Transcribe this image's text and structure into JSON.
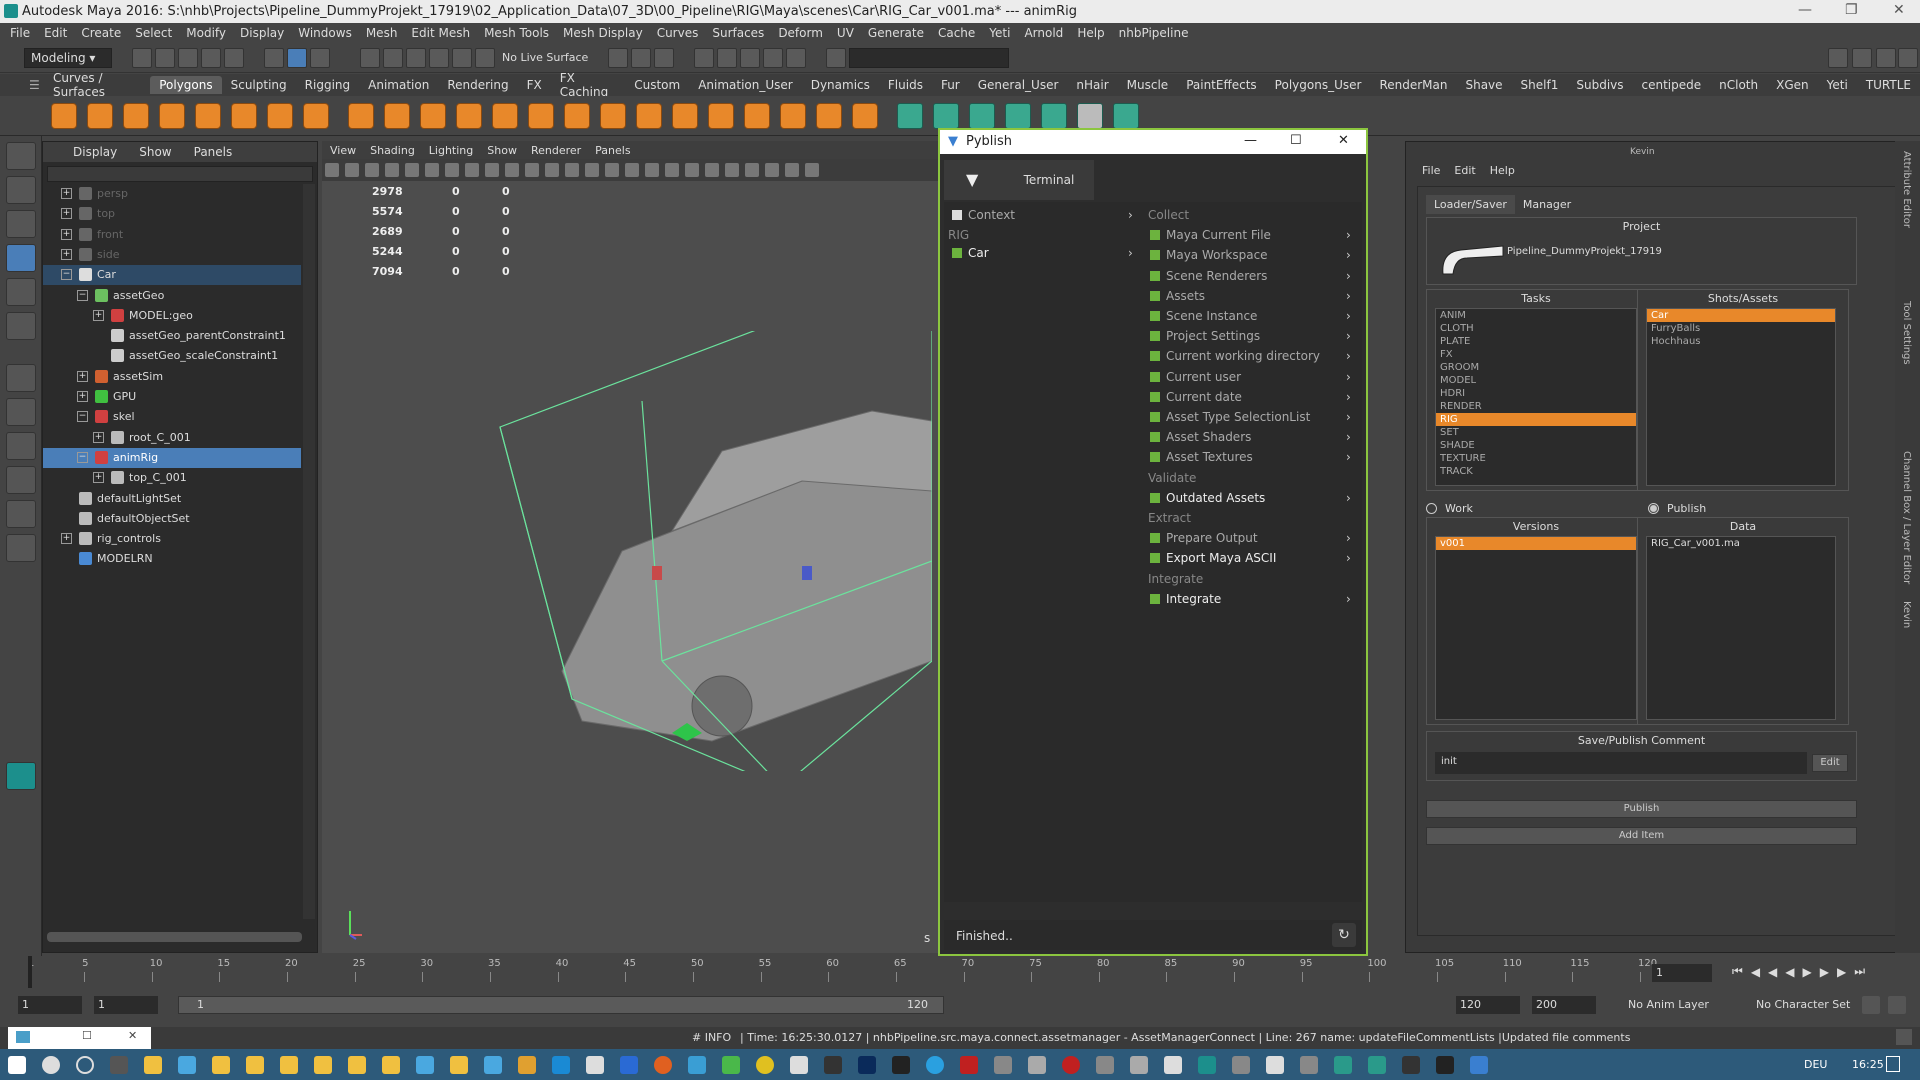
{
  "window": {
    "title": "Autodesk Maya 2016: S:\\nhb\\Projects\\Pipeline_DummyProjekt_17919\\02_Application_Data\\07_3D\\00_Pipeline\\RIG\\Maya\\scenes\\Car\\RIG_Car_v001.ma*   ---   animRig"
  },
  "menubar": [
    "File",
    "Edit",
    "Create",
    "Select",
    "Modify",
    "Display",
    "Windows",
    "Mesh",
    "Edit Mesh",
    "Mesh Tools",
    "Mesh Display",
    "Curves",
    "Surfaces",
    "Deform",
    "UV",
    "Generate",
    "Cache",
    "Yeti",
    "Arnold",
    "Help",
    "nhbPipeline"
  ],
  "statusline": {
    "mode": "Modeling",
    "live_surface": "No Live Surface"
  },
  "shelf_tabs": {
    "items": [
      "Curves / Surfaces",
      "Polygons",
      "Sculpting",
      "Rigging",
      "Animation",
      "Rendering",
      "FX",
      "FX Caching",
      "Custom",
      "Animation_User",
      "Dynamics",
      "Fluids",
      "Fur",
      "General_User",
      "nHair",
      "Muscle",
      "PaintEffects",
      "Polygons_User",
      "RenderMan",
      "Shave",
      "Shelf1",
      "Subdivs",
      "centipede",
      "nCloth",
      "XGen",
      "Yeti",
      "TURTLE"
    ],
    "active": "Polygons"
  },
  "outliner": {
    "menu": [
      "Display",
      "Show",
      "Panels"
    ],
    "items": [
      {
        "label": "persp",
        "depth": 0,
        "dim": true
      },
      {
        "label": "top",
        "depth": 0,
        "dim": true
      },
      {
        "label": "front",
        "depth": 0,
        "dim": true
      },
      {
        "label": "side",
        "depth": 0,
        "dim": true
      },
      {
        "label": "Car",
        "depth": 0,
        "sel": "light"
      },
      {
        "label": "assetGeo",
        "depth": 1
      },
      {
        "label": "MODEL:geo",
        "depth": 2
      },
      {
        "label": "assetGeo_parentConstraint1",
        "depth": 2
      },
      {
        "label": "assetGeo_scaleConstraint1",
        "depth": 2
      },
      {
        "label": "assetSim",
        "depth": 1
      },
      {
        "label": "GPU",
        "depth": 1
      },
      {
        "label": "skel",
        "depth": 1
      },
      {
        "label": "root_C_001",
        "depth": 2
      },
      {
        "label": "animRig",
        "depth": 1,
        "sel": "full"
      },
      {
        "label": "top_C_001",
        "depth": 2
      },
      {
        "label": "defaultLightSet",
        "depth": 0
      },
      {
        "label": "defaultObjectSet",
        "depth": 0
      },
      {
        "label": "rig_controls",
        "depth": 0
      },
      {
        "label": "MODELRN",
        "depth": 0
      }
    ]
  },
  "viewport": {
    "menu": [
      "View",
      "Shading",
      "Lighting",
      "Show",
      "Renderer",
      "Panels"
    ],
    "hud": [
      [
        "2978",
        "0",
        "0"
      ],
      [
        "5574",
        "0",
        "0"
      ],
      [
        "2689",
        "0",
        "0"
      ],
      [
        "5244",
        "0",
        "0"
      ],
      [
        "7094",
        "0",
        "0"
      ]
    ],
    "partial_label": "s"
  },
  "pyblish": {
    "title": "Pyblish",
    "tab_terminal": "Terminal",
    "left": {
      "context_label": "Context",
      "family": "RIG",
      "instance": "Car"
    },
    "sections": [
      {
        "name": "Collect",
        "plugins": [
          "Maya Current File",
          "Maya Workspace",
          "Scene Renderers",
          "Assets",
          "Scene Instance",
          "Project Settings",
          "Current working directory",
          "Current user",
          "Current date",
          "Asset Type SelectionList",
          "Asset Shaders",
          "Asset Textures"
        ]
      },
      {
        "name": "Validate",
        "plugins": [
          "Outdated Assets"
        ]
      },
      {
        "name": "Extract",
        "plugins": [
          "Prepare Output",
          "Export Maya ASCII"
        ]
      },
      {
        "name": "Integrate",
        "plugins": [
          "Integrate"
        ]
      }
    ],
    "bright_plugins": [
      "Outdated Assets",
      "Export Maya ASCII",
      "Integrate"
    ],
    "status": "Finished.."
  },
  "manager": {
    "header_user": "Kevin",
    "menu": [
      "File",
      "Edit",
      "Help"
    ],
    "tabs": [
      "Loader/Saver",
      "Manager"
    ],
    "project_label": "Project",
    "project_name": "Pipeline_DummyProjekt_17919",
    "tasks_label": "Tasks",
    "tasks": [
      "ANIM",
      "CLOTH",
      "PLATE",
      "FX",
      "GROOM",
      "MODEL",
      "HDRI",
      "RENDER",
      "RIG",
      "SET",
      "SHADE",
      "TEXTURE",
      "TRACK"
    ],
    "task_selected": "RIG",
    "shots_label": "Shots/Assets",
    "shots": [
      "Car",
      "FurryBalls",
      "Hochhaus"
    ],
    "shot_selected": "Car",
    "radio_work": "Work",
    "radio_publish": "Publish",
    "versions_label": "Versions",
    "versions": [
      "v001"
    ],
    "data_label": "Data",
    "data": [
      "RIG_Car_v001.ma"
    ],
    "comment_label": "Save/Publish Comment",
    "comment": "init",
    "edit_btn": "Edit",
    "publish_btn": "Publish",
    "additem_btn": "Add Item",
    "side_tabs": [
      "Attribute Editor",
      "Tool Settings",
      "Channel Box / Layer Editor",
      "Kevin"
    ]
  },
  "timeline": {
    "ticks": [
      "1",
      "5",
      "10",
      "15",
      "20",
      "25",
      "30",
      "35",
      "40",
      "45",
      "50",
      "55",
      "60",
      "65",
      "70",
      "75",
      "80",
      "85",
      "90",
      "95",
      "100",
      "105",
      "110",
      "115",
      "120"
    ],
    "current": "1"
  },
  "range": {
    "start": "1",
    "start2": "1",
    "slider_start": "1",
    "slider_end": "120",
    "end": "120",
    "end2": "200",
    "anim_layer": "No Anim Layer",
    "char_set": "No Character Set"
  },
  "cmdline": {
    "info": "# INFO",
    "message": "| Time: 16:25:30.0127 | nhbPipeline.src.maya.connect.assetmanager - AssetManagerConnect | Line: 267 name: updateFileCommentLists |Updated file comments"
  },
  "taskbar": {
    "lang": "DEU",
    "time": "16:25"
  }
}
